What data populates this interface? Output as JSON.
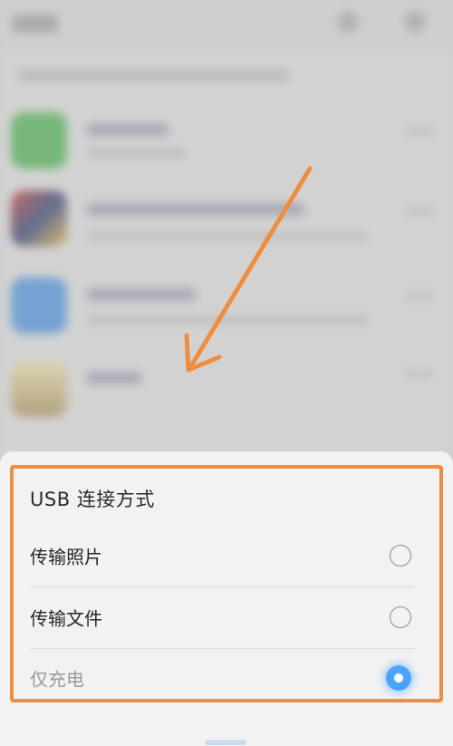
{
  "dialog": {
    "title": "USB 连接方式",
    "options": [
      {
        "label": "传输照片",
        "selected": false
      },
      {
        "label": "传输文件",
        "selected": false
      },
      {
        "label": "仅充电",
        "selected": true
      }
    ]
  },
  "colors": {
    "annotation": "#f08d3c",
    "radio_selected": "#4aa3ff",
    "sheet_background": "#f2f2f2"
  }
}
